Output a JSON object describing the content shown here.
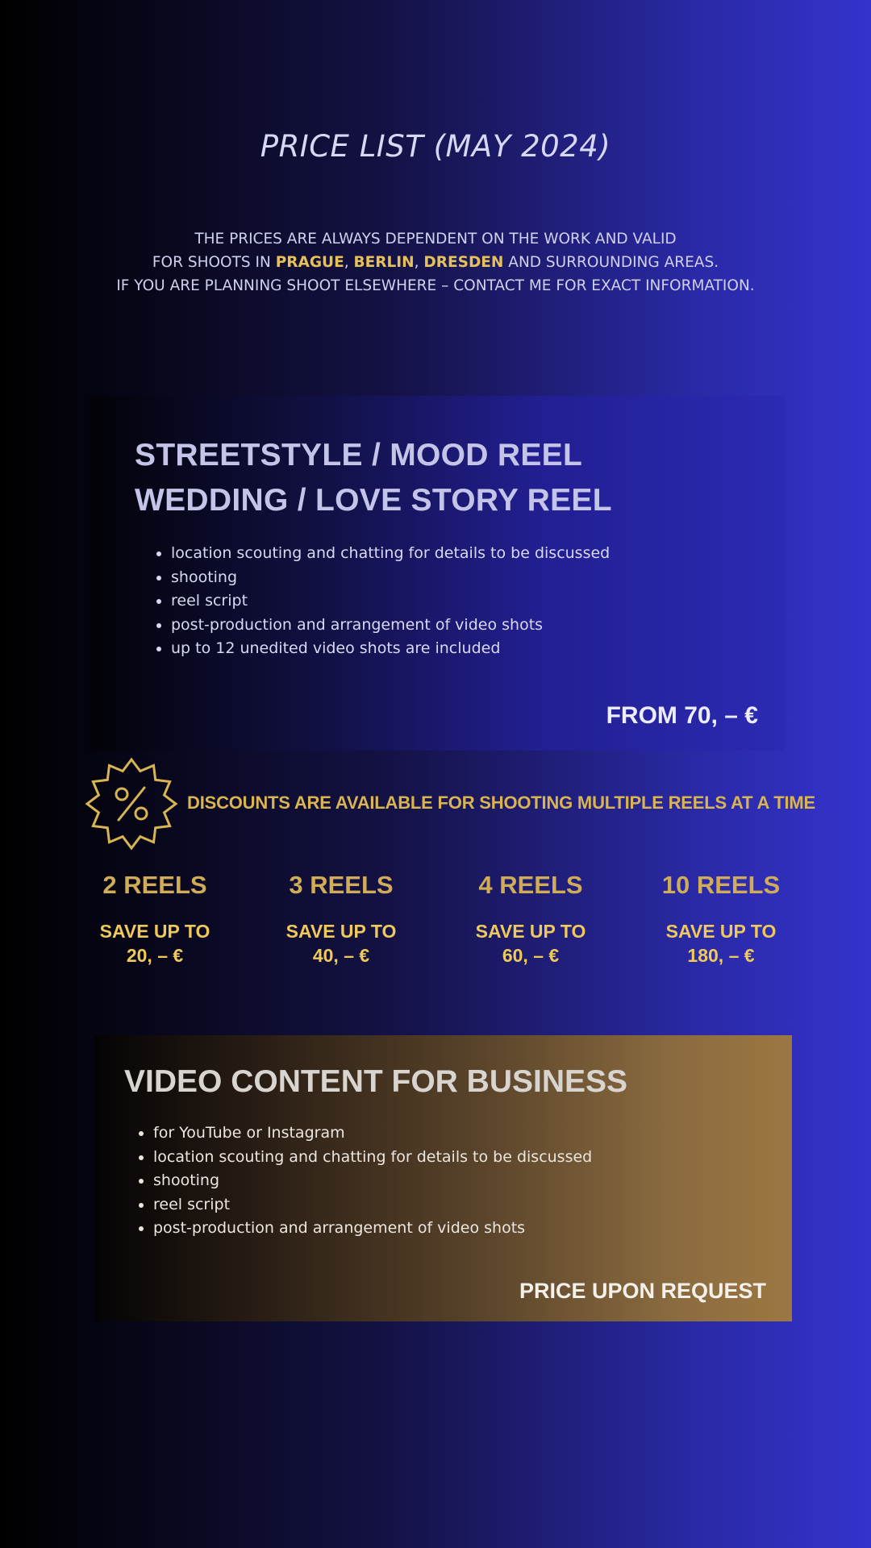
{
  "header": {
    "title": "PRICE LIST (MAY 2024)"
  },
  "intro": {
    "line1": "THE PRICES ARE ALWAYS DEPENDENT ON THE WORK AND VALID",
    "line2_prefix": "FOR SHOOTS IN ",
    "city1": "PRAGUE",
    "sep1": ", ",
    "city2": "BERLIN",
    "sep2": ", ",
    "city3": "DRESDEN",
    "line2_suffix": " AND SURROUNDING AREAS.",
    "line3": "IF YOU ARE PLANNING SHOOT ELSEWHERE – CONTACT ME FOR EXACT INFORMATION."
  },
  "reels_card": {
    "heading_line1": "STREETSTYLE / MOOD REEL",
    "heading_line2": "WEDDING / LOVE STORY REEL",
    "items": [
      "location scouting and chatting for details to be discussed",
      "shooting",
      "reel script",
      "post-production and arrangement of video shots",
      "up to 12 unedited video shots are included"
    ],
    "price": "FROM 70, – €"
  },
  "discount": {
    "icon": "percent-badge-icon",
    "text": "DISCOUNTS ARE AVAILABLE FOR SHOOTING MULTIPLE REELS AT A TIME",
    "tiers": [
      {
        "label": "2 REELS",
        "save_line1": "SAVE UP TO",
        "save_line2": "20, – €"
      },
      {
        "label": "3 REELS",
        "save_line1": "SAVE UP TO",
        "save_line2": "40, – €"
      },
      {
        "label": "4 REELS",
        "save_line1": "SAVE UP TO",
        "save_line2": "60, – €"
      },
      {
        "label": "10 REELS",
        "save_line1": "SAVE UP TO",
        "save_line2": "180, – €"
      }
    ]
  },
  "business_card": {
    "heading": "VIDEO CONTENT FOR BUSINESS",
    "items": [
      "for YouTube or Instagram",
      "location scouting and chatting for details to be discussed",
      "shooting",
      "reel script",
      "post-production and arrangement of video shots"
    ],
    "price": "PRICE UPON REQUEST"
  },
  "colors": {
    "accent_gold": "#e6c15a",
    "background_blue": "#3433cc",
    "business_bronze": "#9c7742"
  }
}
